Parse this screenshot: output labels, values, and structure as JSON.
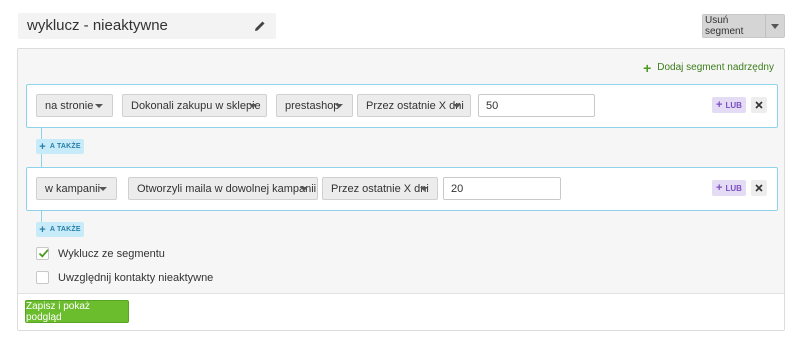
{
  "segment": {
    "name": "wyklucz - nieaktywne",
    "remove_label": "Usuń segment"
  },
  "panel": {
    "add_parent_label": "Dodaj segment nadrzędny",
    "conditions": [
      {
        "scope": "na stronie",
        "action": "Dokonali zakupu w sklepie",
        "source": "prestashop",
        "period": "Przez ostatnie X dni",
        "value": "50",
        "or_label": "LUB"
      },
      {
        "scope": "w kampanii",
        "action": "Otworzyli maila w dowolnej kampanii",
        "period": "Przez ostatnie X dni",
        "value": "20",
        "or_label": "LUB"
      }
    ],
    "and_label": "A TAKŻE",
    "options": [
      {
        "label": "Wyklucz ze segmentu",
        "checked": true
      },
      {
        "label": "Uwzględnij kontakty nieaktywne",
        "checked": false
      }
    ],
    "save_label": "Zapisz i pokaż podgląd"
  },
  "colors": {
    "accent_green": "#6bbd2e",
    "condition_border": "#8fd3ea",
    "or_purple": "#7c4fc1",
    "and_blue": "#2a7fa8"
  }
}
